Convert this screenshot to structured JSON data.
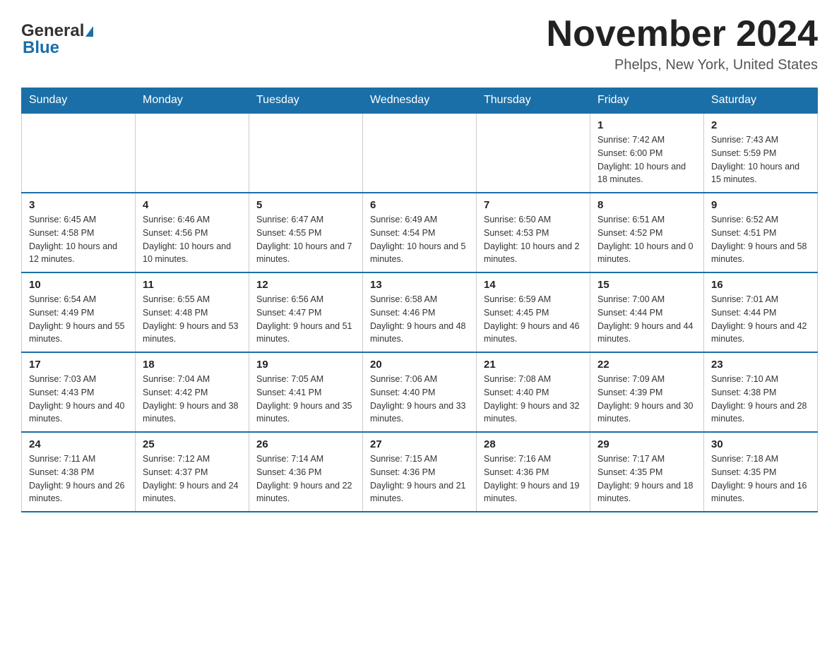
{
  "header": {
    "logo_general": "General",
    "logo_blue": "Blue",
    "title": "November 2024",
    "subtitle": "Phelps, New York, United States"
  },
  "weekdays": [
    "Sunday",
    "Monday",
    "Tuesday",
    "Wednesday",
    "Thursday",
    "Friday",
    "Saturday"
  ],
  "weeks": [
    [
      {
        "day": "",
        "sunrise": "",
        "sunset": "",
        "daylight": ""
      },
      {
        "day": "",
        "sunrise": "",
        "sunset": "",
        "daylight": ""
      },
      {
        "day": "",
        "sunrise": "",
        "sunset": "",
        "daylight": ""
      },
      {
        "day": "",
        "sunrise": "",
        "sunset": "",
        "daylight": ""
      },
      {
        "day": "",
        "sunrise": "",
        "sunset": "",
        "daylight": ""
      },
      {
        "day": "1",
        "sunrise": "Sunrise: 7:42 AM",
        "sunset": "Sunset: 6:00 PM",
        "daylight": "Daylight: 10 hours and 18 minutes."
      },
      {
        "day": "2",
        "sunrise": "Sunrise: 7:43 AM",
        "sunset": "Sunset: 5:59 PM",
        "daylight": "Daylight: 10 hours and 15 minutes."
      }
    ],
    [
      {
        "day": "3",
        "sunrise": "Sunrise: 6:45 AM",
        "sunset": "Sunset: 4:58 PM",
        "daylight": "Daylight: 10 hours and 12 minutes."
      },
      {
        "day": "4",
        "sunrise": "Sunrise: 6:46 AM",
        "sunset": "Sunset: 4:56 PM",
        "daylight": "Daylight: 10 hours and 10 minutes."
      },
      {
        "day": "5",
        "sunrise": "Sunrise: 6:47 AM",
        "sunset": "Sunset: 4:55 PM",
        "daylight": "Daylight: 10 hours and 7 minutes."
      },
      {
        "day": "6",
        "sunrise": "Sunrise: 6:49 AM",
        "sunset": "Sunset: 4:54 PM",
        "daylight": "Daylight: 10 hours and 5 minutes."
      },
      {
        "day": "7",
        "sunrise": "Sunrise: 6:50 AM",
        "sunset": "Sunset: 4:53 PM",
        "daylight": "Daylight: 10 hours and 2 minutes."
      },
      {
        "day": "8",
        "sunrise": "Sunrise: 6:51 AM",
        "sunset": "Sunset: 4:52 PM",
        "daylight": "Daylight: 10 hours and 0 minutes."
      },
      {
        "day": "9",
        "sunrise": "Sunrise: 6:52 AM",
        "sunset": "Sunset: 4:51 PM",
        "daylight": "Daylight: 9 hours and 58 minutes."
      }
    ],
    [
      {
        "day": "10",
        "sunrise": "Sunrise: 6:54 AM",
        "sunset": "Sunset: 4:49 PM",
        "daylight": "Daylight: 9 hours and 55 minutes."
      },
      {
        "day": "11",
        "sunrise": "Sunrise: 6:55 AM",
        "sunset": "Sunset: 4:48 PM",
        "daylight": "Daylight: 9 hours and 53 minutes."
      },
      {
        "day": "12",
        "sunrise": "Sunrise: 6:56 AM",
        "sunset": "Sunset: 4:47 PM",
        "daylight": "Daylight: 9 hours and 51 minutes."
      },
      {
        "day": "13",
        "sunrise": "Sunrise: 6:58 AM",
        "sunset": "Sunset: 4:46 PM",
        "daylight": "Daylight: 9 hours and 48 minutes."
      },
      {
        "day": "14",
        "sunrise": "Sunrise: 6:59 AM",
        "sunset": "Sunset: 4:45 PM",
        "daylight": "Daylight: 9 hours and 46 minutes."
      },
      {
        "day": "15",
        "sunrise": "Sunrise: 7:00 AM",
        "sunset": "Sunset: 4:44 PM",
        "daylight": "Daylight: 9 hours and 44 minutes."
      },
      {
        "day": "16",
        "sunrise": "Sunrise: 7:01 AM",
        "sunset": "Sunset: 4:44 PM",
        "daylight": "Daylight: 9 hours and 42 minutes."
      }
    ],
    [
      {
        "day": "17",
        "sunrise": "Sunrise: 7:03 AM",
        "sunset": "Sunset: 4:43 PM",
        "daylight": "Daylight: 9 hours and 40 minutes."
      },
      {
        "day": "18",
        "sunrise": "Sunrise: 7:04 AM",
        "sunset": "Sunset: 4:42 PM",
        "daylight": "Daylight: 9 hours and 38 minutes."
      },
      {
        "day": "19",
        "sunrise": "Sunrise: 7:05 AM",
        "sunset": "Sunset: 4:41 PM",
        "daylight": "Daylight: 9 hours and 35 minutes."
      },
      {
        "day": "20",
        "sunrise": "Sunrise: 7:06 AM",
        "sunset": "Sunset: 4:40 PM",
        "daylight": "Daylight: 9 hours and 33 minutes."
      },
      {
        "day": "21",
        "sunrise": "Sunrise: 7:08 AM",
        "sunset": "Sunset: 4:40 PM",
        "daylight": "Daylight: 9 hours and 32 minutes."
      },
      {
        "day": "22",
        "sunrise": "Sunrise: 7:09 AM",
        "sunset": "Sunset: 4:39 PM",
        "daylight": "Daylight: 9 hours and 30 minutes."
      },
      {
        "day": "23",
        "sunrise": "Sunrise: 7:10 AM",
        "sunset": "Sunset: 4:38 PM",
        "daylight": "Daylight: 9 hours and 28 minutes."
      }
    ],
    [
      {
        "day": "24",
        "sunrise": "Sunrise: 7:11 AM",
        "sunset": "Sunset: 4:38 PM",
        "daylight": "Daylight: 9 hours and 26 minutes."
      },
      {
        "day": "25",
        "sunrise": "Sunrise: 7:12 AM",
        "sunset": "Sunset: 4:37 PM",
        "daylight": "Daylight: 9 hours and 24 minutes."
      },
      {
        "day": "26",
        "sunrise": "Sunrise: 7:14 AM",
        "sunset": "Sunset: 4:36 PM",
        "daylight": "Daylight: 9 hours and 22 minutes."
      },
      {
        "day": "27",
        "sunrise": "Sunrise: 7:15 AM",
        "sunset": "Sunset: 4:36 PM",
        "daylight": "Daylight: 9 hours and 21 minutes."
      },
      {
        "day": "28",
        "sunrise": "Sunrise: 7:16 AM",
        "sunset": "Sunset: 4:36 PM",
        "daylight": "Daylight: 9 hours and 19 minutes."
      },
      {
        "day": "29",
        "sunrise": "Sunrise: 7:17 AM",
        "sunset": "Sunset: 4:35 PM",
        "daylight": "Daylight: 9 hours and 18 minutes."
      },
      {
        "day": "30",
        "sunrise": "Sunrise: 7:18 AM",
        "sunset": "Sunset: 4:35 PM",
        "daylight": "Daylight: 9 hours and 16 minutes."
      }
    ]
  ]
}
